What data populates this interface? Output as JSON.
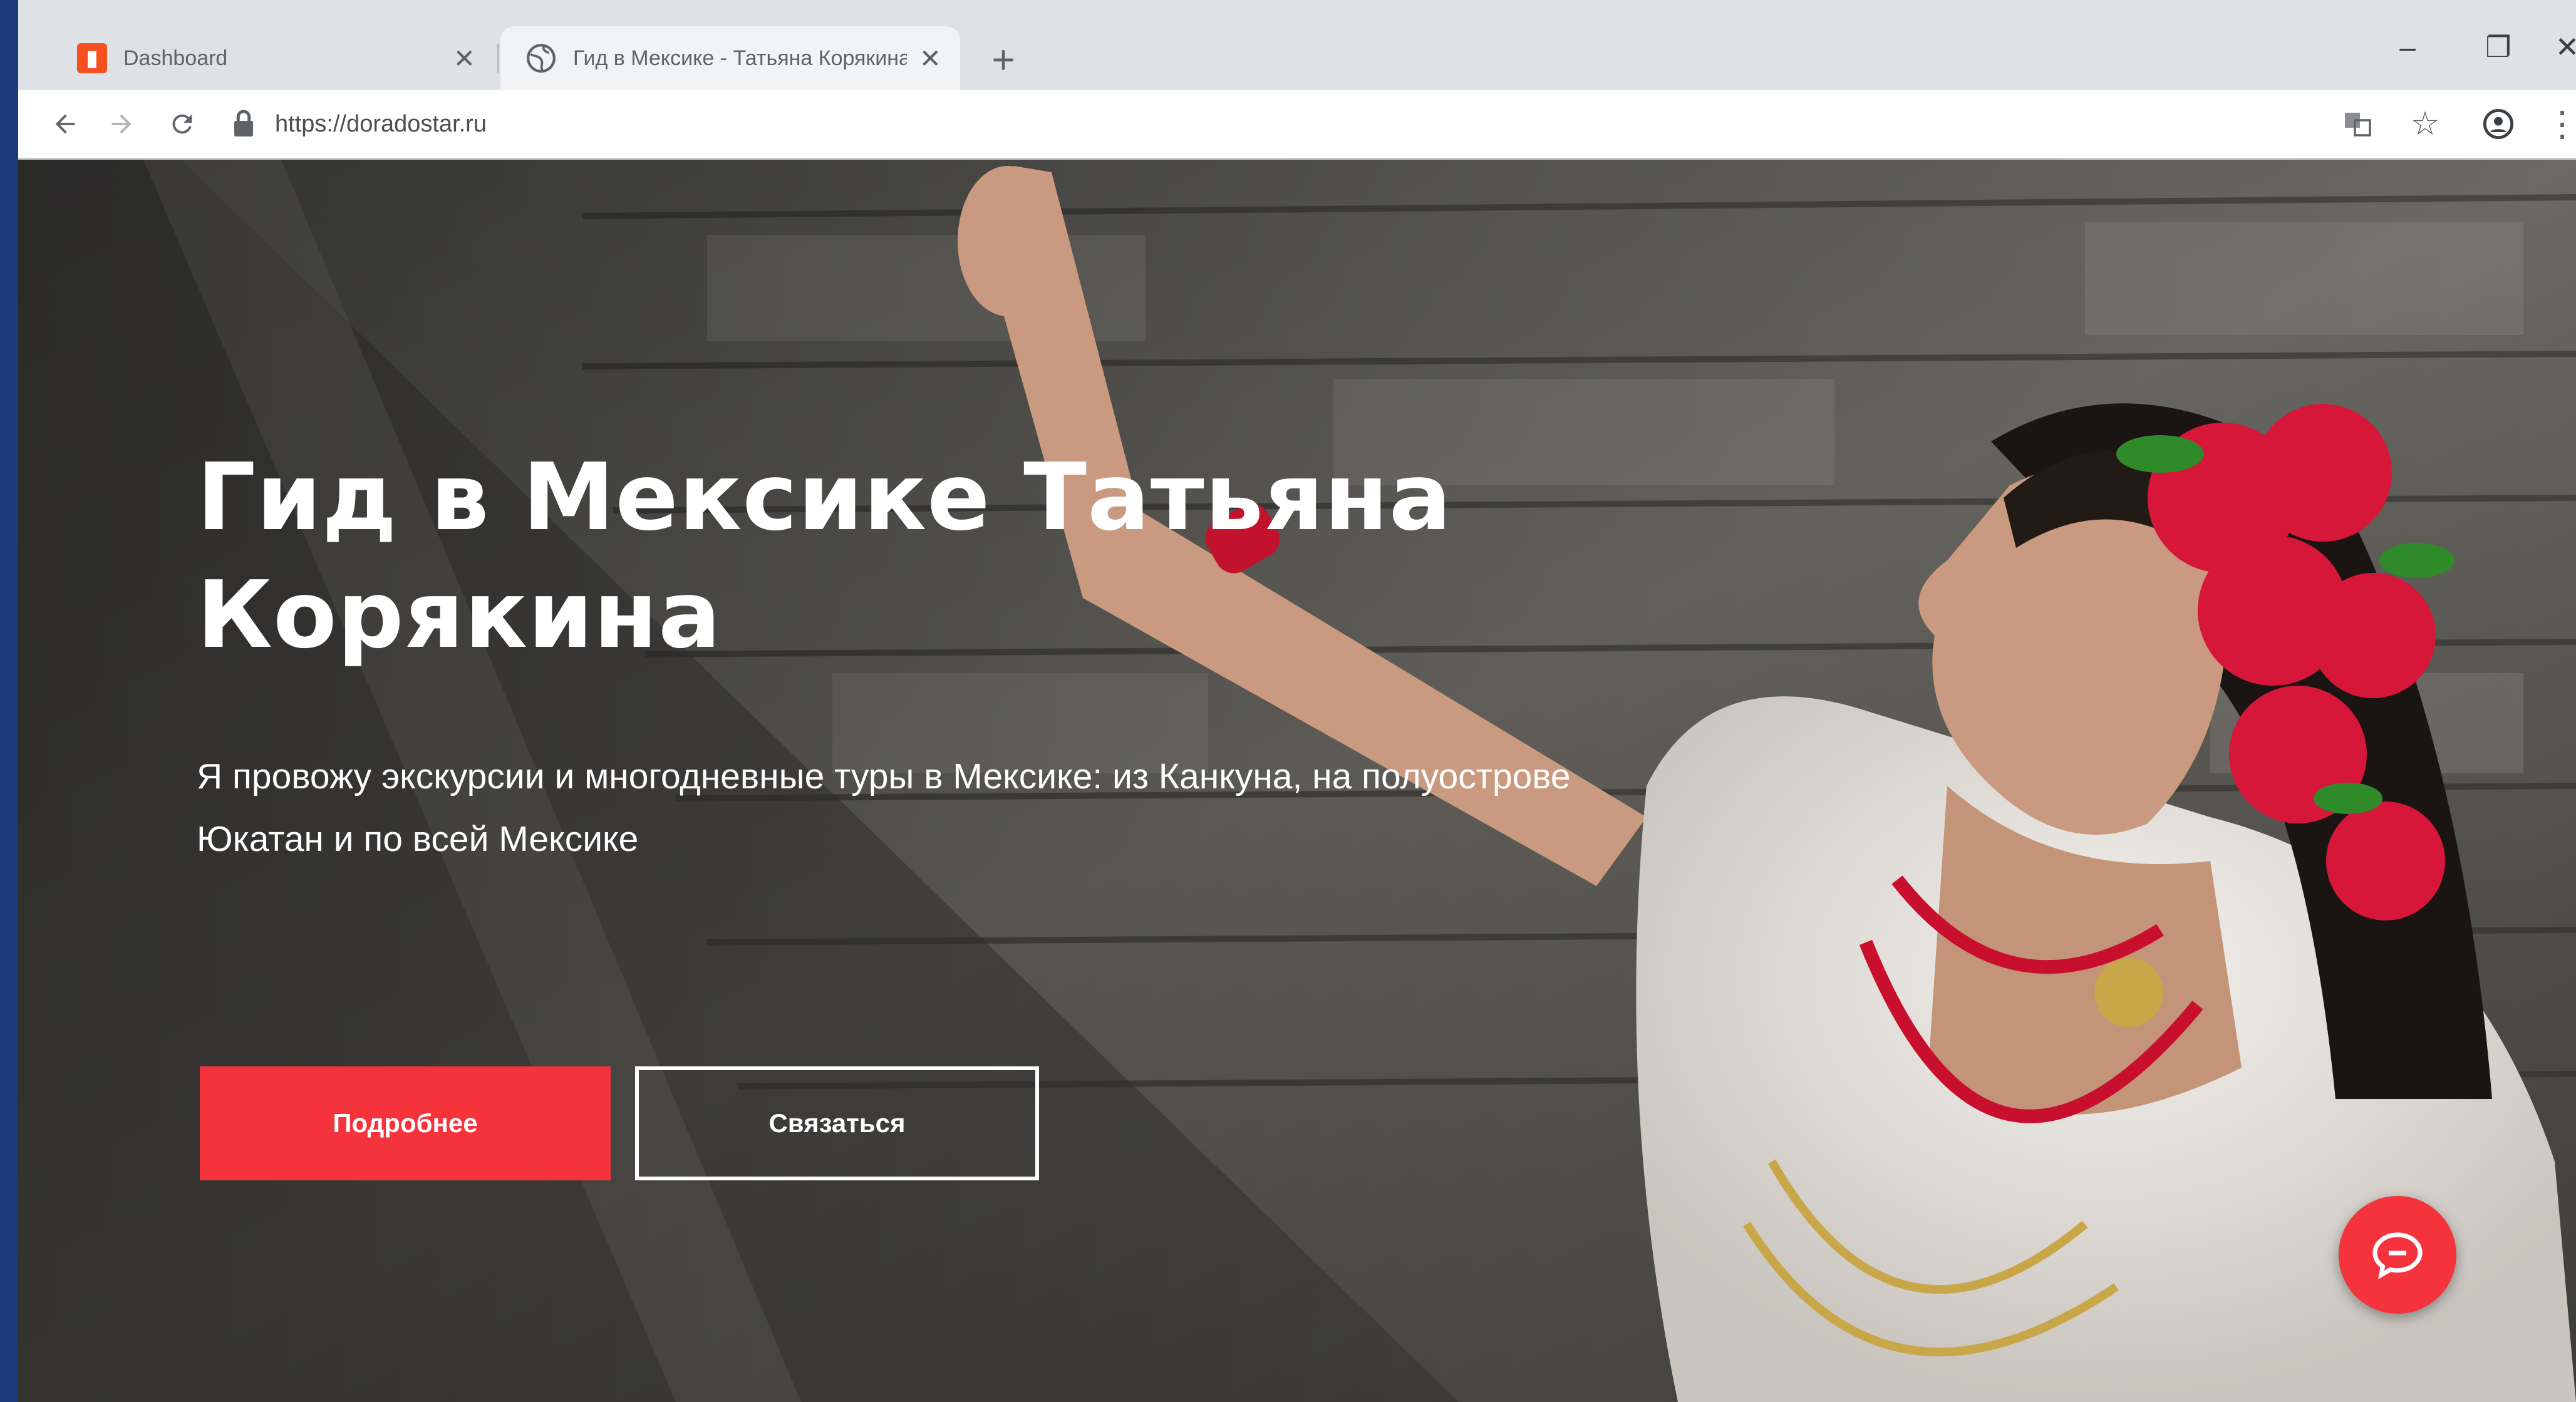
{
  "browser": {
    "tabs": [
      {
        "title": "Dashboard",
        "favicon": "dashboard-icon",
        "active": false
      },
      {
        "title": "Гид в Мексике - Татьяна Корякина",
        "favicon": "globe-icon",
        "active": true
      }
    ],
    "new_tab_label": "+",
    "address_bar": {
      "url": "https://doradostar.ru"
    },
    "window_controls": {
      "minimize": "–",
      "maximize": "❐",
      "close": "✕"
    },
    "toolbar_icons": [
      "translate-icon",
      "star-icon",
      "profile-icon",
      "menu-icon"
    ]
  },
  "hero": {
    "title": "Гид в Мексике Татьяна Корякина",
    "subtitle": "Я провожу экскурсии и многодневные туры в Мексике: из Канкуна, на полуострове Юкатан и по всей Мексике",
    "primary_button": "Подробнее",
    "secondary_button": "Связаться"
  },
  "colors": {
    "accent": "#f4333c",
    "tab_bar": "#dee1e6",
    "desktop": "#1f3a7a"
  }
}
